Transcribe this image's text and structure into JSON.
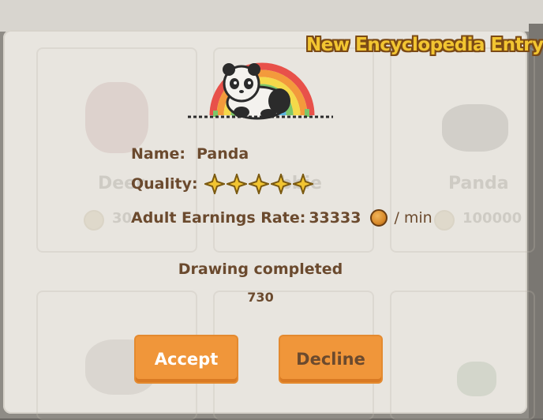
{
  "dialog": {
    "title": "New Encyclopedia Entry!",
    "name_label": "Name:",
    "name_value": "Panda",
    "quality_label": "Quality:",
    "quality_stars": 5,
    "earnings_label": "Adult Earnings Rate:",
    "earnings_value": "33333",
    "earnings_unit": "/ min",
    "status_text": "Drawing completed",
    "draw_count": "730",
    "accept_label": "Accept",
    "decline_label": "Decline"
  },
  "background": {
    "cards": [
      {
        "name": "Deer",
        "price": "30"
      },
      {
        "name": "bbie",
        "price": ""
      },
      {
        "name": "Panda",
        "price": "100000"
      }
    ]
  },
  "colors": {
    "accent_button": "#f0963a",
    "title_text": "#f2c531",
    "body_text": "#6b4a2e",
    "modal_bg": "#e8e5df"
  }
}
